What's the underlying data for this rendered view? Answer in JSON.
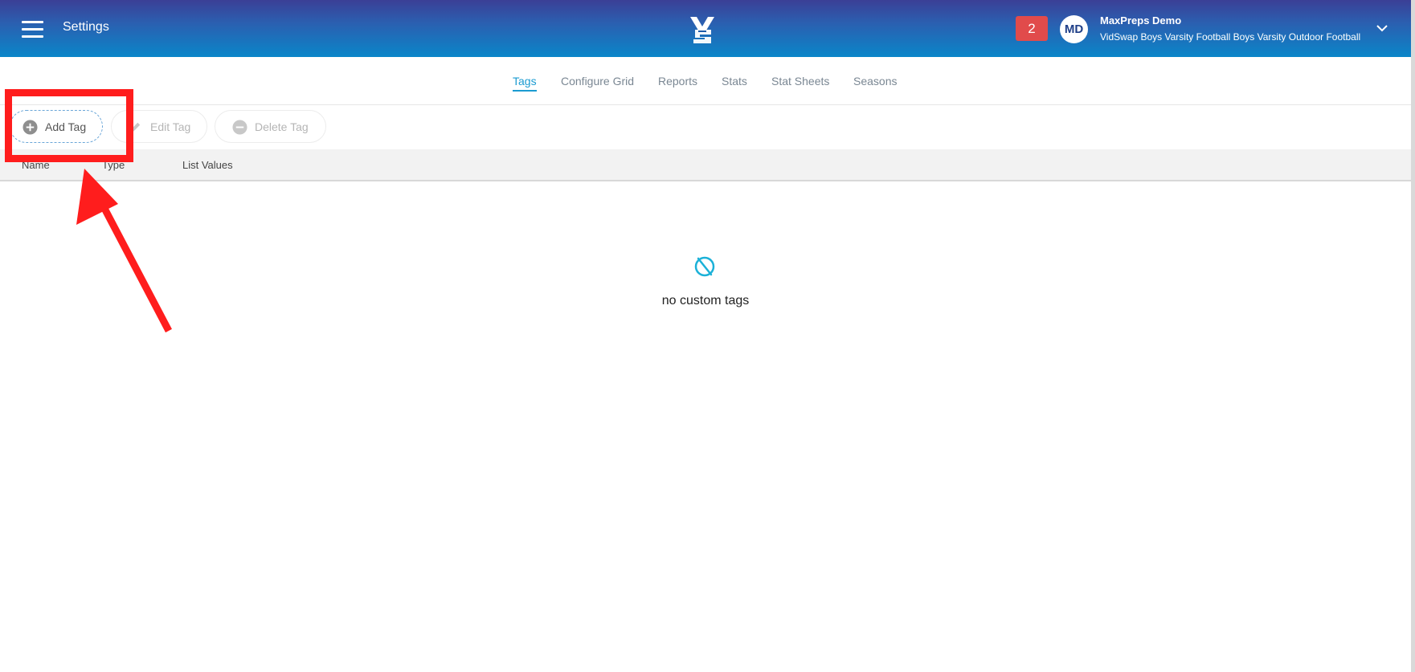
{
  "header": {
    "title": "Settings",
    "notifications_count": "2",
    "user": {
      "initials": "MD",
      "name": "MaxPreps Demo",
      "subtitle": "VidSwap Boys Varsity Football Boys Varsity Outdoor Football"
    }
  },
  "tabs": [
    {
      "label": "Tags",
      "active": true
    },
    {
      "label": "Configure Grid",
      "active": false
    },
    {
      "label": "Reports",
      "active": false
    },
    {
      "label": "Stats",
      "active": false
    },
    {
      "label": "Stat Sheets",
      "active": false
    },
    {
      "label": "Seasons",
      "active": false
    }
  ],
  "toolbar": {
    "add_label": "Add Tag",
    "edit_label": "Edit Tag",
    "delete_label": "Delete Tag"
  },
  "table": {
    "columns": [
      "Name",
      "Type",
      "List Values"
    ]
  },
  "empty_state": {
    "message": "no custom tags"
  },
  "colors": {
    "header_top": "#3b3f96",
    "header_bottom": "#0a86c9",
    "accent": "#1b9bd1",
    "badge": "#e14b4b",
    "annotation": "#ff1d1d"
  }
}
